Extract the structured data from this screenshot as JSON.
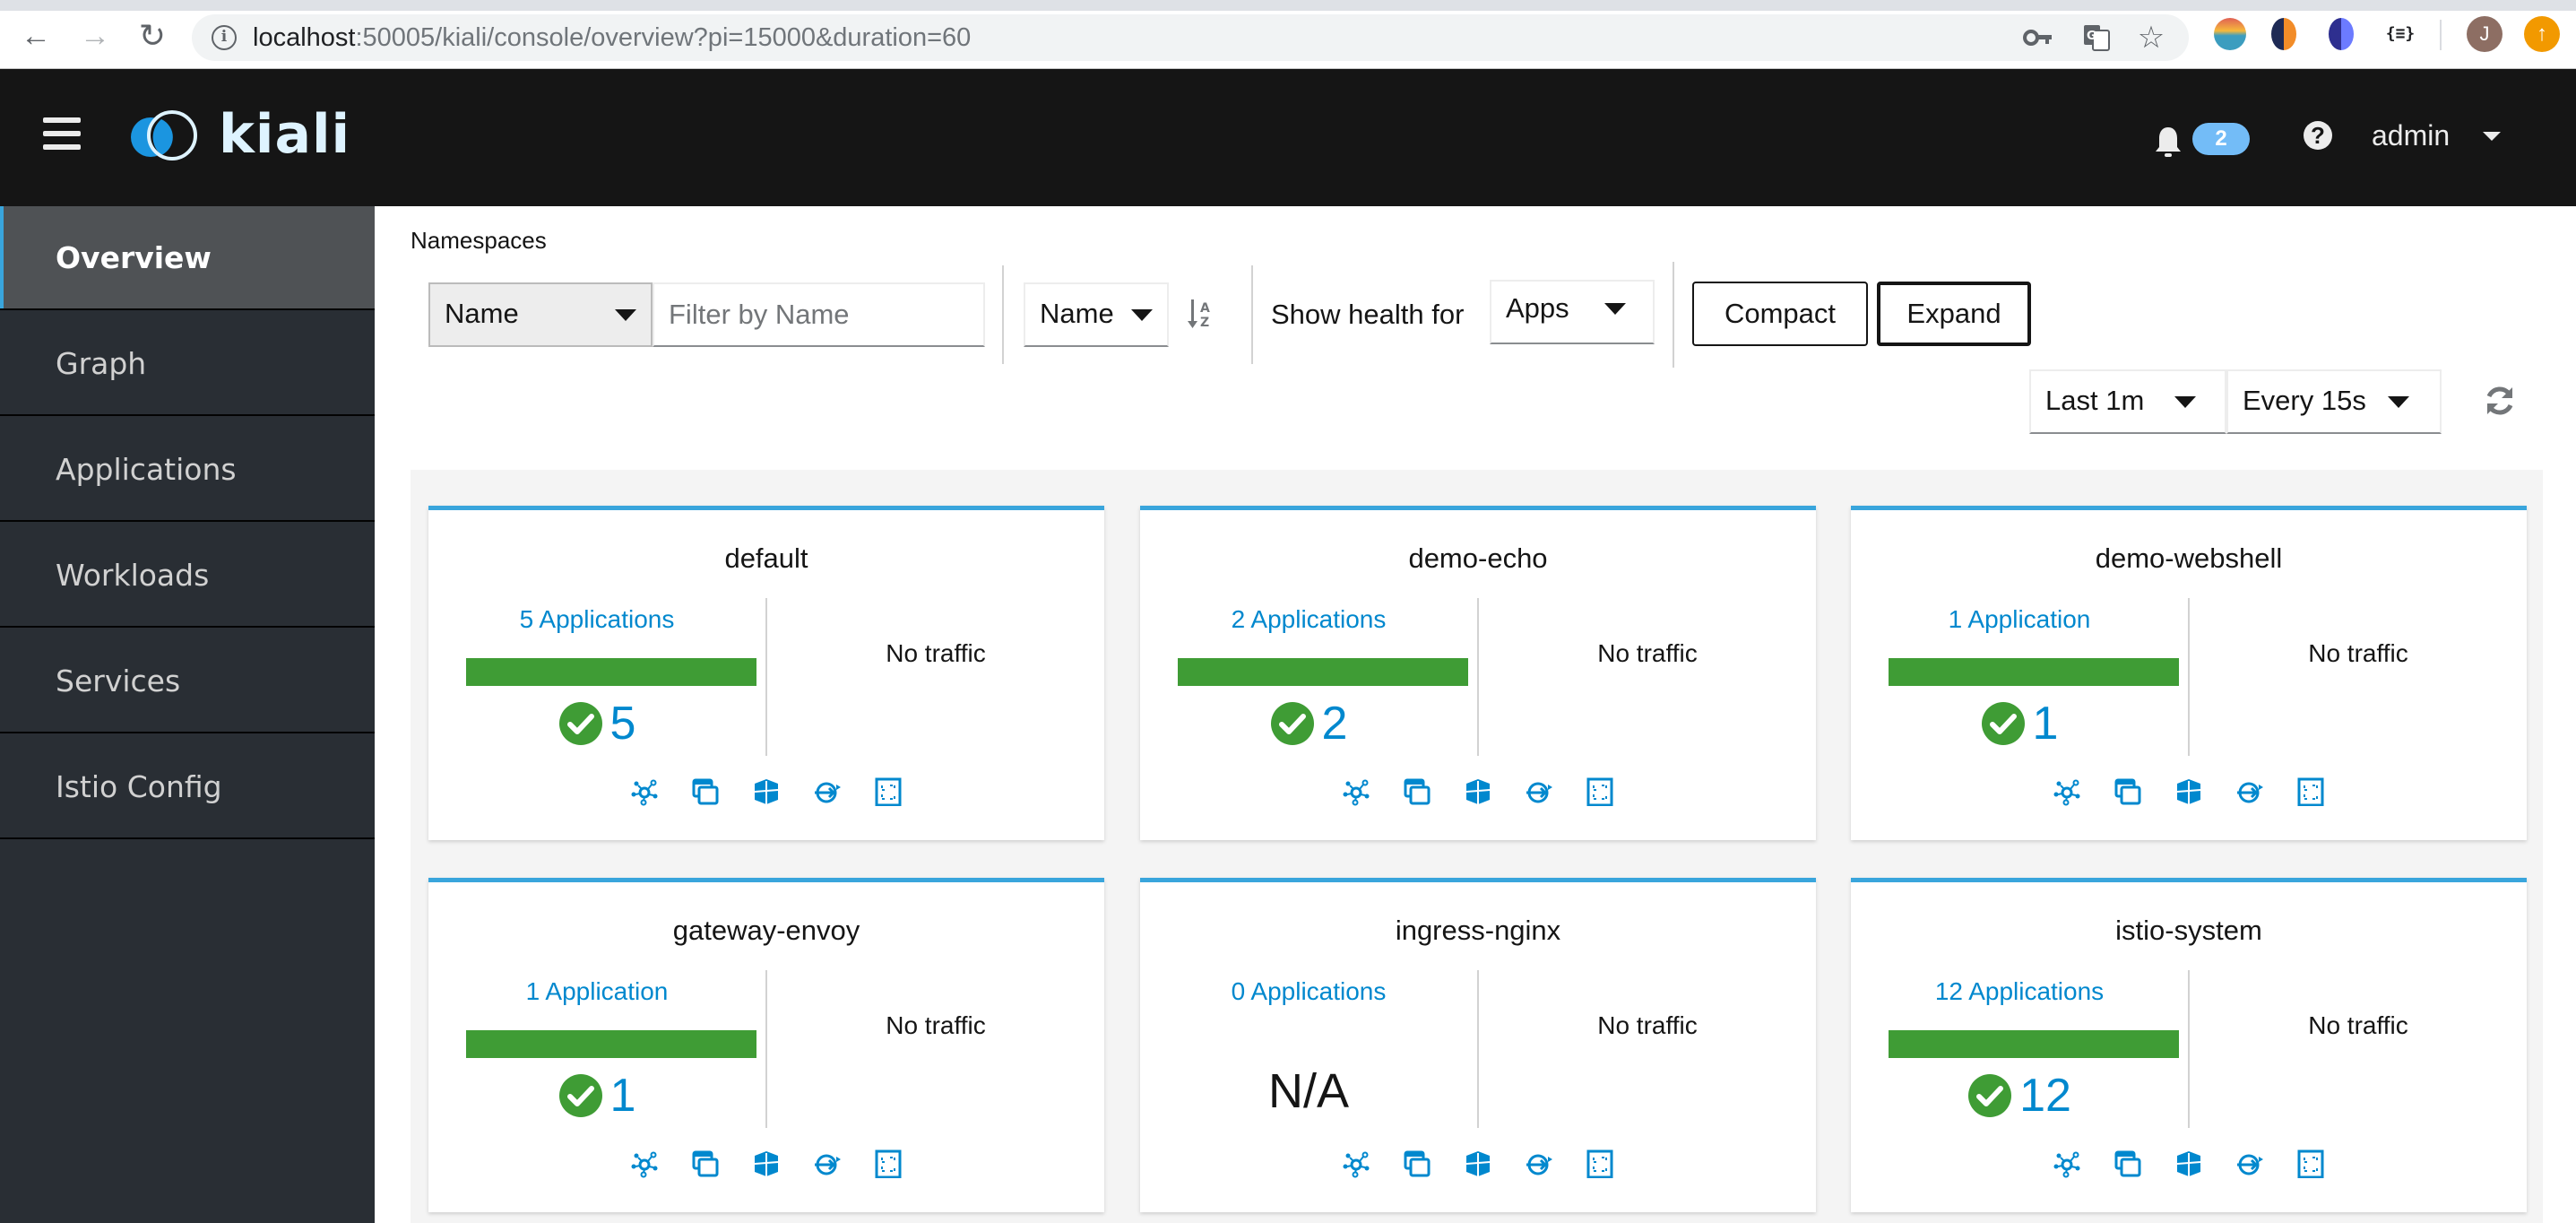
{
  "browser": {
    "url_host": "localhost",
    "url_rest": ":50005/kiali/console/overview?pi=15000&duration=60",
    "avatar_initial": "J"
  },
  "masthead": {
    "logo_text": "kiali",
    "notification_count": "2",
    "username": "admin"
  },
  "sidebar": {
    "items": [
      {
        "label": "Overview",
        "active": true
      },
      {
        "label": "Graph",
        "active": false
      },
      {
        "label": "Applications",
        "active": false
      },
      {
        "label": "Workloads",
        "active": false
      },
      {
        "label": "Services",
        "active": false
      },
      {
        "label": "Istio Config",
        "active": false
      }
    ]
  },
  "toolbar": {
    "section_title": "Namespaces",
    "filter_type": "Name",
    "filter_placeholder": "Filter by Name",
    "filter_value": "",
    "sort_field": "Name",
    "health_label": "Show health for",
    "health_type": "Apps",
    "compact_label": "Compact",
    "expand_label": "Expand",
    "time_range": "Last 1m",
    "refresh_interval": "Every 15s"
  },
  "colors": {
    "accent": "#39a5dc",
    "link": "#0088ce",
    "healthy": "#3f9c35",
    "masthead_bg": "#151515",
    "sidebar_bg": "#292e34",
    "badge": "#73bcf7"
  },
  "namespaces": [
    {
      "name": "default",
      "apps_label": "5 Applications",
      "healthy_fraction": 1.0,
      "healthy_count": "5",
      "na": false,
      "traffic": "No traffic"
    },
    {
      "name": "demo-echo",
      "apps_label": "2 Applications",
      "healthy_fraction": 1.0,
      "healthy_count": "2",
      "na": false,
      "traffic": "No traffic"
    },
    {
      "name": "demo-webshell",
      "apps_label": "1 Application",
      "healthy_fraction": 1.0,
      "healthy_count": "1",
      "na": false,
      "traffic": "No traffic"
    },
    {
      "name": "gateway-envoy",
      "apps_label": "1 Application",
      "healthy_fraction": 1.0,
      "healthy_count": "1",
      "na": false,
      "traffic": "No traffic"
    },
    {
      "name": "ingress-nginx",
      "apps_label": "0 Applications",
      "healthy_fraction": 0,
      "healthy_count": "",
      "na": true,
      "na_label": "N/A",
      "traffic": "No traffic"
    },
    {
      "name": "istio-system",
      "apps_label": "12 Applications",
      "healthy_fraction": 1.0,
      "healthy_count": "12",
      "na": false,
      "traffic": "No traffic"
    }
  ],
  "card_links": [
    "topology-icon",
    "applications-icon",
    "workloads-icon",
    "services-icon",
    "istio-config-icon"
  ]
}
